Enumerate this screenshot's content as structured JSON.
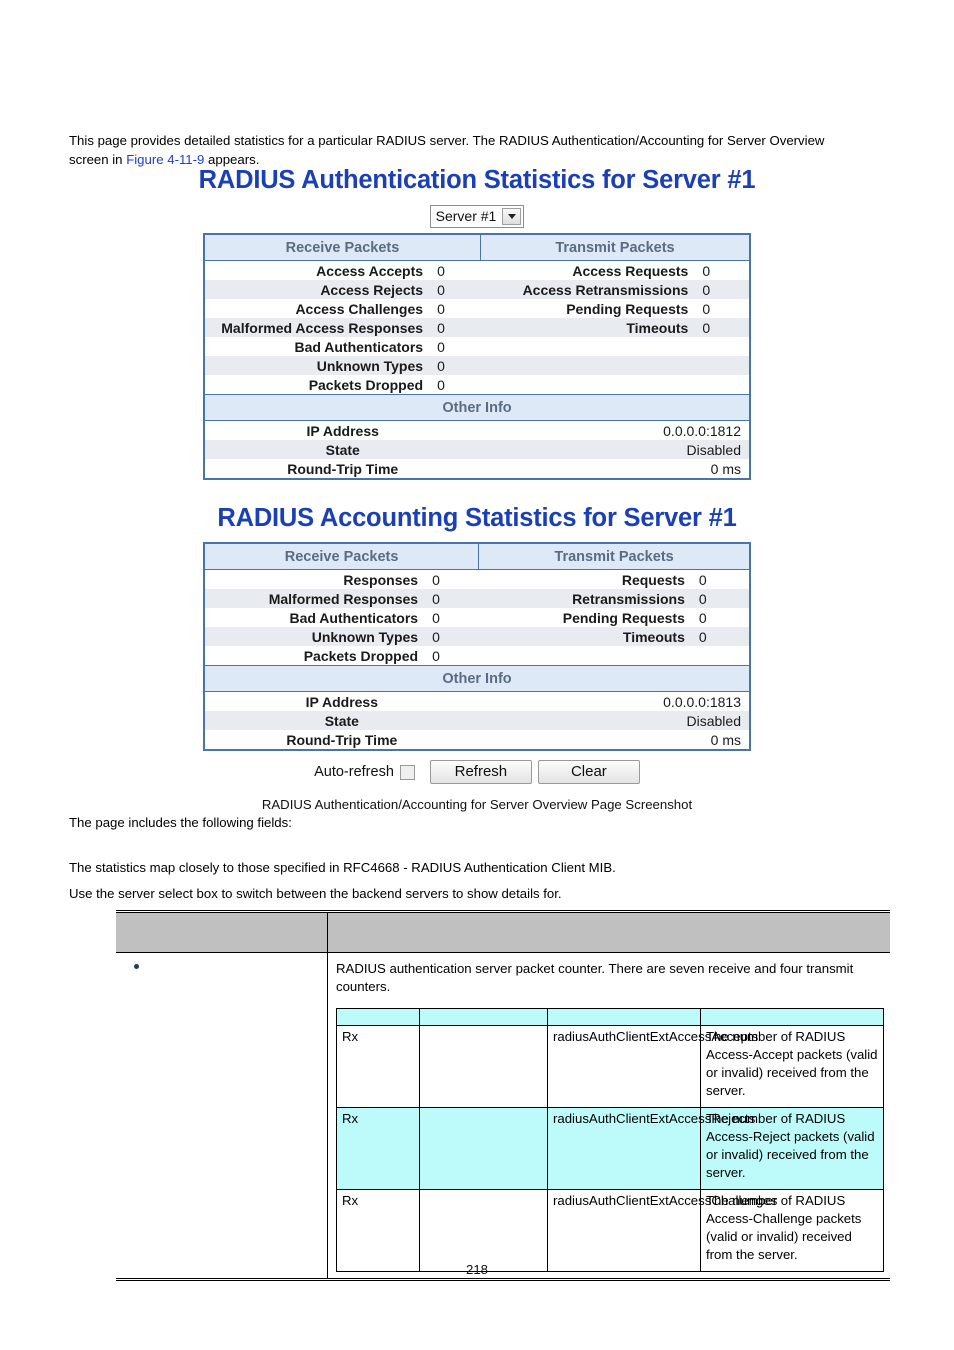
{
  "intro": {
    "text_before_link": "This page provides detailed statistics for a particular RADIUS server. The RADIUS Authentication/Accounting for Server Overview screen in ",
    "link_text": "Figure 4-11-9",
    "text_after_link": " appears."
  },
  "screenshot": {
    "auth_title": "RADIUS Authentication Statistics for Server #1",
    "acct_title": "RADIUS Accounting Statistics for Server #1",
    "server_select": {
      "selected": "Server #1",
      "options": [
        "Server #1"
      ],
      "arrow_icon": "chevron-down-icon"
    },
    "auth_table": {
      "header_receive": "Receive Packets",
      "header_transmit": "Transmit Packets",
      "rows": [
        {
          "rx_label": "Access Accepts",
          "rx_value": "0",
          "tx_label": "Access Requests",
          "tx_value": "0"
        },
        {
          "rx_label": "Access Rejects",
          "rx_value": "0",
          "tx_label": "Access Retransmissions",
          "tx_value": "0"
        },
        {
          "rx_label": "Access Challenges",
          "rx_value": "0",
          "tx_label": "Pending Requests",
          "tx_value": "0"
        },
        {
          "rx_label": "Malformed Access Responses",
          "rx_value": "0",
          "tx_label": "Timeouts",
          "tx_value": "0"
        },
        {
          "rx_label": "Bad Authenticators",
          "rx_value": "0",
          "tx_label": "",
          "tx_value": ""
        },
        {
          "rx_label": "Unknown Types",
          "rx_value": "0",
          "tx_label": "",
          "tx_value": ""
        },
        {
          "rx_label": "Packets Dropped",
          "rx_value": "0",
          "tx_label": "",
          "tx_value": ""
        }
      ],
      "other_info_header": "Other Info",
      "other_info": [
        {
          "label": "IP Address",
          "value": "0.0.0.0:1812"
        },
        {
          "label": "State",
          "value": "Disabled"
        },
        {
          "label": "Round-Trip Time",
          "value": "0 ms"
        }
      ]
    },
    "acct_table": {
      "header_receive": "Receive Packets",
      "header_transmit": "Transmit Packets",
      "rows": [
        {
          "rx_label": "Responses",
          "rx_value": "0",
          "tx_label": "Requests",
          "tx_value": "0"
        },
        {
          "rx_label": "Malformed Responses",
          "rx_value": "0",
          "tx_label": "Retransmissions",
          "tx_value": "0"
        },
        {
          "rx_label": "Bad Authenticators",
          "rx_value": "0",
          "tx_label": "Pending Requests",
          "tx_value": "0"
        },
        {
          "rx_label": "Unknown Types",
          "rx_value": "0",
          "tx_label": "Timeouts",
          "tx_value": "0"
        },
        {
          "rx_label": "Packets Dropped",
          "rx_value": "0",
          "tx_label": "",
          "tx_value": ""
        }
      ],
      "other_info_header": "Other Info",
      "other_info": [
        {
          "label": "IP Address",
          "value": "0.0.0.0:1813"
        },
        {
          "label": "State",
          "value": "Disabled"
        },
        {
          "label": "Round-Trip Time",
          "value": "0 ms"
        }
      ]
    },
    "controls": {
      "auto_refresh_label": "Auto-refresh",
      "auto_refresh_checked": false,
      "refresh_label": "Refresh",
      "clear_label": "Clear"
    },
    "caption": "RADIUS Authentication/Accounting for Server Overview Page Screenshot"
  },
  "body": {
    "line1": "The page includes the following fields:",
    "line2": "The statistics map closely to those specified in RFC4668 - RADIUS Authentication Client MIB.",
    "line3": "Use the server select box to switch between the backend servers to show details for."
  },
  "fields_table": {
    "header": {
      "col1": "",
      "col2": ""
    },
    "row": {
      "object_cell": "",
      "description": "RADIUS authentication server packet counter. There are seven receive and four transmit counters.",
      "inner_header": {
        "c1": "",
        "c2": "",
        "c3": "",
        "c4": ""
      },
      "inner_rows": [
        {
          "direction": "Rx",
          "blank": "",
          "name": "radiusAuthClientExtAccessAccepts",
          "description": "The number of RADIUS Access-Accept packets (valid or invalid) received from the server."
        },
        {
          "direction": "Rx",
          "blank": "",
          "name": "radiusAuthClientExtAccessRejects",
          "description": "The number of RADIUS Access-Reject packets (valid or invalid) received from the server."
        },
        {
          "direction": "Rx",
          "blank": "",
          "name": "radiusAuthClientExtAccessChallenges",
          "description": "The number of RADIUS Access-Challenge packets (valid or invalid) received from the server."
        }
      ]
    }
  },
  "page_number": "218",
  "colors": {
    "title_blue": "#1b3fb5",
    "link_blue": "#1a3fd4",
    "table_border": "#4a73a8",
    "table_header_bg": "#dde9f7",
    "alt_row_bg": "#e8ecf1",
    "fields_header_bg": "#c0c0c0",
    "cyan_row_bg": "#bdfbfb"
  }
}
